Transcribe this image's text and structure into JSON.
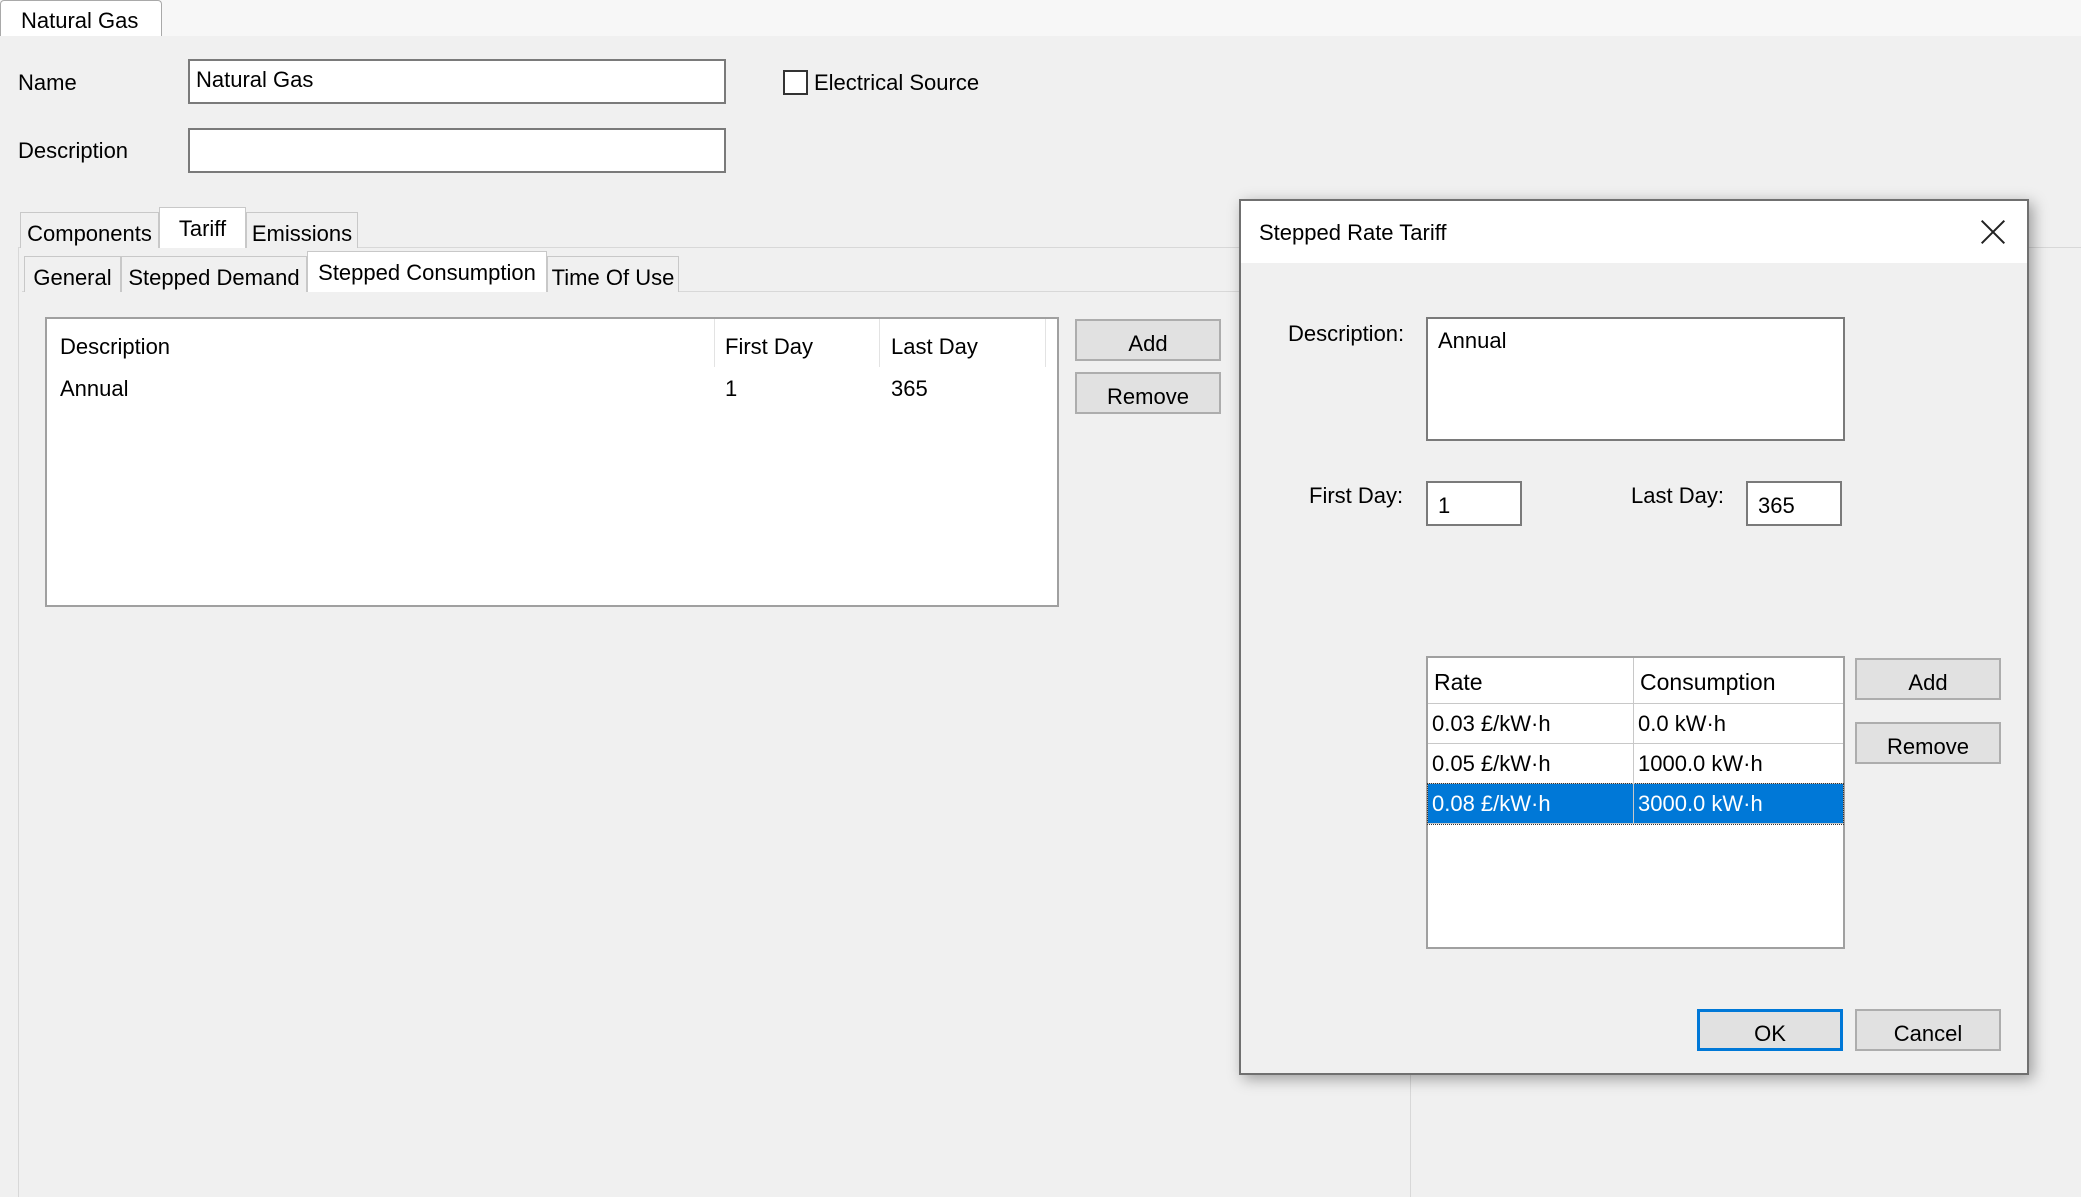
{
  "document_tab": "Natural Gas",
  "form": {
    "name_label": "Name",
    "name_value": "Natural Gas",
    "description_label": "Description",
    "description_value": "",
    "electrical_source_label": "Electrical Source",
    "electrical_source_checked": false
  },
  "main_tabs": [
    "Components",
    "Tariff",
    "Emissions"
  ],
  "main_tab_active": "Tariff",
  "sub_tabs": [
    "General",
    "Stepped Demand",
    "Stepped Consumption",
    "Time Of Use"
  ],
  "sub_tab_active": "Stepped Consumption",
  "periods": {
    "columns": [
      "Description",
      "First Day",
      "Last Day"
    ],
    "rows": [
      {
        "description": "Annual",
        "first_day": "1",
        "last_day": "365"
      }
    ],
    "add_label": "Add",
    "remove_label": "Remove"
  },
  "dialog": {
    "title": "Stepped Rate Tariff",
    "description_label": "Description:",
    "description_value": "Annual",
    "first_day_label": "First Day:",
    "first_day_value": "1",
    "last_day_label": "Last Day:",
    "last_day_value": "365",
    "rates": {
      "columns": [
        "Rate",
        "Consumption"
      ],
      "rows": [
        {
          "rate": "0.03 £/kW·h",
          "consumption": "0.0 kW·h"
        },
        {
          "rate": "0.05 £/kW·h",
          "consumption": "1000.0 kW·h"
        },
        {
          "rate": "0.08 £/kW·h",
          "consumption": "3000.0 kW·h"
        }
      ],
      "selected_row": 2
    },
    "add_label": "Add",
    "remove_label": "Remove",
    "ok_label": "OK",
    "cancel_label": "Cancel"
  },
  "colors": {
    "selection": "#0078d7",
    "window_bg": "#f0f0f0"
  }
}
